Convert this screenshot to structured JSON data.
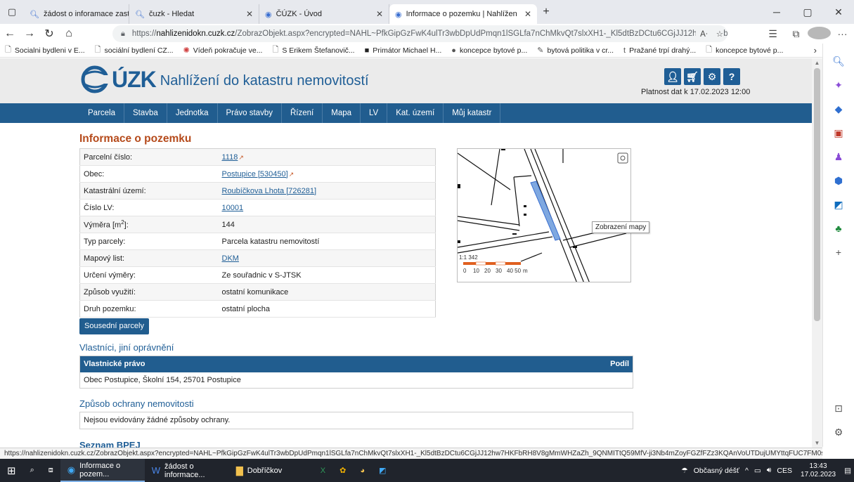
{
  "browser": {
    "tabs": [
      {
        "label": "žádost o inforamace zastupitelst",
        "icon": "search-icon"
      },
      {
        "label": "čuzk - Hledat",
        "icon": "search-icon"
      },
      {
        "label": "ČÚZK - Úvod",
        "icon": "cuzk-favicon"
      },
      {
        "label": "Informace o pozemku | Nahlížen",
        "icon": "cuzk-favicon"
      }
    ],
    "url_prefix": "https://",
    "url_host": "nahlizenidokn.cuzk.cz",
    "url_rest": "/ZobrazObjekt.aspx?encrypted=NAHL~PfkGipGzFwK4ulTr3wbDpUdPmqn1lSGLfa7nChMkvQt7slxXH1-_Kl5dtBzDCtu6CGjJJ12hw7HKFbRH...",
    "favorites": [
      "Socialni bydleni v E...",
      "sociální bydlení CZ...",
      "Vídeň pokračuje ve...",
      "S Erikem Štefanovič...",
      "Primátor Michael H...",
      "koncepce bytové p...",
      "bytová politika v cr...",
      "Pražané trpí drahý...",
      "koncepce bytové p..."
    ],
    "status_url": "https://nahlizenidokn.cuzk.cz/ZobrazObjekt.aspx?encrypted=NAHL~PfkGipGzFwK4ulTr3wbDpUdPmqn1lSGLfa7nChMkvQt7slxXH1-_Kl5dtBzDCtu6CGjJJ12hw7HKFbRH8V8gMmWHZaZh_9QNMITtQ59MfV-ji3Nb4mZoyFGZfFZz3KQAnVoUTDujUMYttqFUC7FM0s1qWy-XgWBR..."
  },
  "site": {
    "logo_text": "ÚZK",
    "subtitle": "Nahlížení do katastru nemovitostí",
    "validity": "Platnost dat k 17.02.2023 12:00",
    "nav": [
      "Parcela",
      "Stavba",
      "Jednotka",
      "Právo stavby",
      "Řízení",
      "Mapa",
      "LV",
      "Kat. území",
      "Můj katastr"
    ]
  },
  "parcel": {
    "heading": "Informace o pozemku",
    "rows": [
      {
        "label": "Parcelní číslo:",
        "value": "1118"
      },
      {
        "label": "Obec:",
        "value": "Postupice [530450]"
      },
      {
        "label": "Katastrální území:",
        "value": "Roubíčkova Lhota [726281]"
      },
      {
        "label": "Číslo LV:",
        "value": "10001"
      },
      {
        "label": "Výměra [m",
        "sup": "2",
        "label_end": "]:",
        "value": "144"
      },
      {
        "label": "Typ parcely:",
        "value": "Parcela katastru nemovitostí"
      },
      {
        "label": "Mapový list:",
        "value": "DKM"
      },
      {
        "label": "Určení výměry:",
        "value": "Ze souřadnic v S-JTSK"
      },
      {
        "label": "Způsob využití:",
        "value": "ostatní komunikace"
      },
      {
        "label": "Druh pozemku:",
        "value": "ostatní plocha"
      }
    ],
    "neighbors_button": "Sousední parcely"
  },
  "map": {
    "scale_label": "1:1 342",
    "scale_ticks": [
      "0",
      "10",
      "20",
      "30",
      "40 50",
      "m"
    ],
    "tooltip": "Zobrazení mapy"
  },
  "owners": {
    "heading": "Vlastníci, jiní oprávnění",
    "col_right": "Vlastnické právo",
    "col_share": "Podíl",
    "owner": "Obec Postupice, Školní 154, 25701 Postupice"
  },
  "protection": {
    "heading": "Způsob ochrany nemovitosti",
    "text": "Nejsou evidovány žádné způsoby ochrany."
  },
  "bpej": {
    "heading": "Seznam BPEJ"
  },
  "taskbar": {
    "apps": [
      "Informace o pozem...",
      "žádost o informace...",
      "Dobříčkov"
    ],
    "weather": "Občasný déšť",
    "lang": "CES",
    "time": "13:43",
    "date": "17.02.2023"
  }
}
